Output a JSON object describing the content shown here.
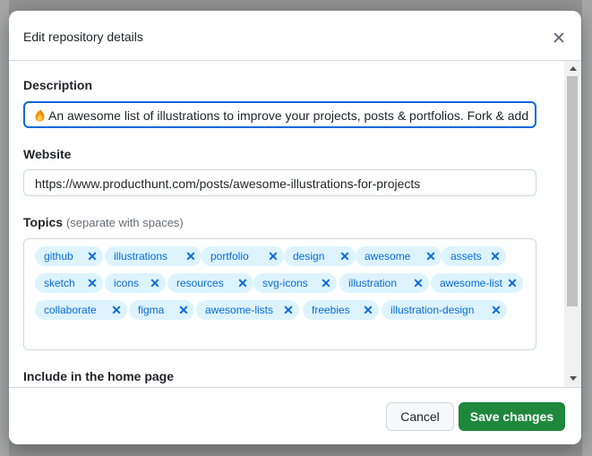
{
  "dialog": {
    "title": "Edit repository details",
    "close_icon": "close-icon"
  },
  "description": {
    "label": "Description",
    "value": "An awesome list of illustrations to improve your projects, posts & portfolios. Fork & add",
    "leading_icon": "fire-emoji-icon"
  },
  "website": {
    "label": "Website",
    "value": "https://www.producthunt.com/posts/awesome-illustrations-for-projects"
  },
  "topics": {
    "label": "Topics",
    "hint": "(separate with spaces)",
    "items": [
      "github",
      "illustrations",
      "portfolio",
      "design",
      "awesome",
      "assets",
      "sketch",
      "icons",
      "resources",
      "svg-icons",
      "illustration",
      "awesome-list",
      "collaborate",
      "figma",
      "awesome-lists",
      "freebies",
      "illustration-design"
    ],
    "remove_icon": "✕"
  },
  "home_page": {
    "label": "Include in the home page"
  },
  "footer": {
    "cancel_label": "Cancel",
    "save_label": "Save changes"
  },
  "colors": {
    "primary": "#1f883d",
    "accent": "#0969da",
    "topic_bg": "#ddf4ff"
  }
}
